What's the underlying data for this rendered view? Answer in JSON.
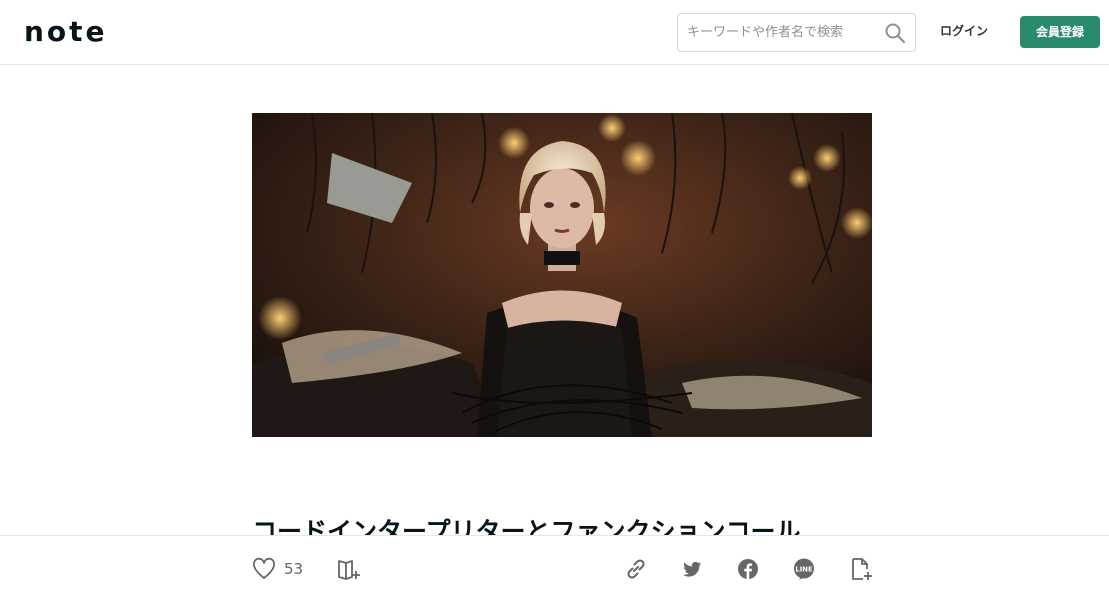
{
  "header": {
    "logo": "note",
    "search": {
      "placeholder": "キーワードや作者名で検索",
      "icon": "search-icon"
    },
    "login_label": "ログイン",
    "signup_label": "会員登録",
    "brand_color": "#2a8a6e"
  },
  "article": {
    "title": "コードインタープリターとファンクションコール"
  },
  "actions": {
    "like_count": "53",
    "icons": [
      "heart-icon",
      "magazine-add-icon",
      "link-icon",
      "twitter-icon",
      "facebook-icon",
      "line-icon",
      "embed-icon"
    ]
  }
}
